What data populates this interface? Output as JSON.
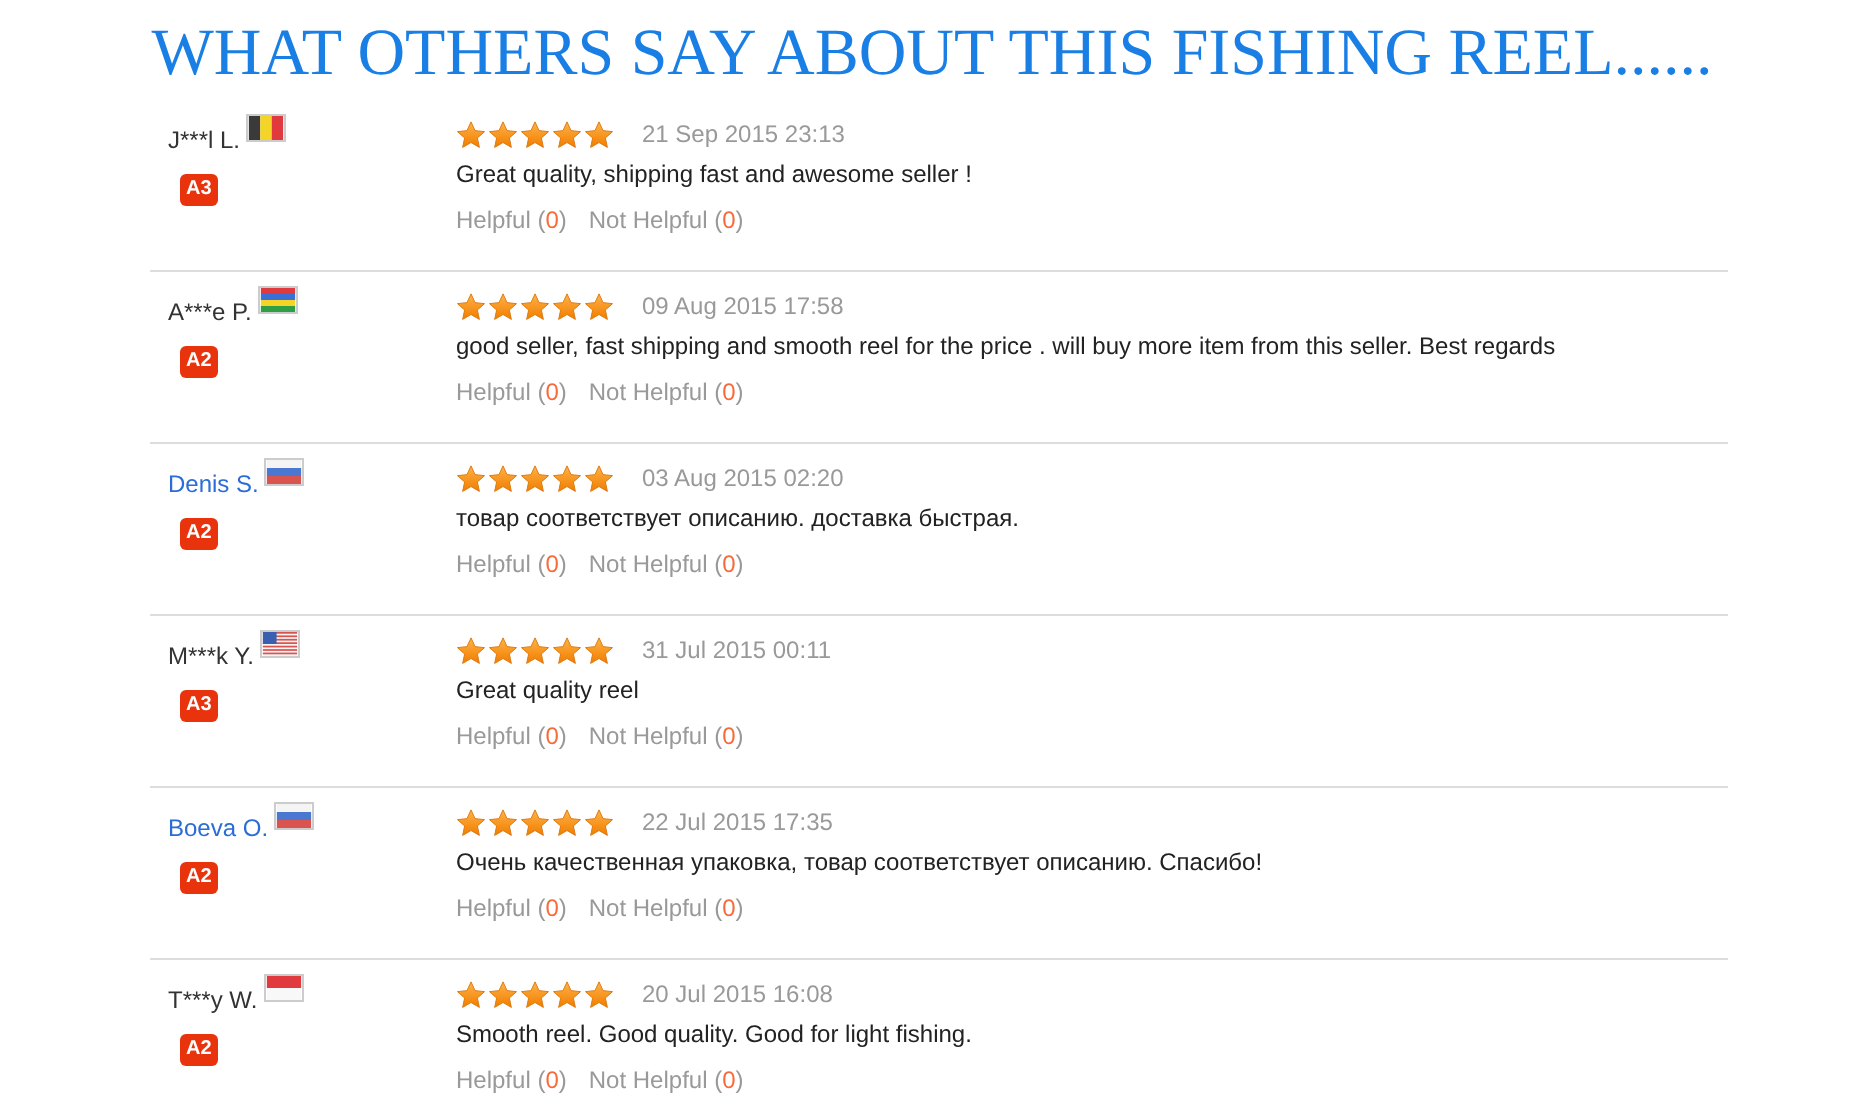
{
  "title": "WHAT OTHERS SAY ABOUT THIS FISHING REEL......",
  "reviews": [
    {
      "name": "J***l L.",
      "name_link": false,
      "badge": "A3",
      "stars": 5,
      "date": "21 Sep 2015 23:13",
      "text": "Great quality, shipping fast and awesome seller !",
      "helpful": [
        "Helpful (",
        "0",
        ")"
      ],
      "not_helpful": [
        "Not Helpful (",
        "0",
        ")"
      ]
    },
    {
      "name": "A***e P.",
      "name_link": false,
      "badge": "A2",
      "stars": 5,
      "date": "09 Aug 2015 17:58",
      "text": "good seller, fast shipping and smooth reel for the price . will buy more item from this seller. Best regards",
      "helpful": [
        "Helpful (",
        "0",
        ")"
      ],
      "not_helpful": [
        "Not Helpful (",
        "0",
        ")"
      ]
    },
    {
      "name": "Denis S.",
      "name_link": true,
      "badge": "A2",
      "stars": 5,
      "date": "03 Aug 2015 02:20",
      "text": "товар соответствует описанию. доставка быстрая.",
      "helpful": [
        "Helpful (",
        "0",
        ")"
      ],
      "not_helpful": [
        "Not Helpful (",
        "0",
        ")"
      ]
    },
    {
      "name": "M***k Y.",
      "name_link": false,
      "badge": "A3",
      "stars": 5,
      "date": "31 Jul 2015 00:11",
      "text": "Great quality reel",
      "helpful": [
        "Helpful (",
        "0",
        ")"
      ],
      "not_helpful": [
        "Not Helpful (",
        "0",
        ")"
      ]
    },
    {
      "name": "Boeva O.",
      "name_link": true,
      "badge": "A2",
      "stars": 5,
      "date": "22 Jul 2015 17:35",
      "text": "Очень качественная упаковка, товар соответствует описанию. Спасибо!",
      "helpful": [
        "Helpful (",
        "0",
        ")"
      ],
      "not_helpful": [
        "Not Helpful (",
        "0",
        ")"
      ]
    },
    {
      "name": "T***y W.",
      "name_link": false,
      "badge": "A2",
      "stars": 5,
      "date": "20 Jul 2015 16:08",
      "text": "Smooth reel. Good quality. Good for light fishing.",
      "helpful": [
        "Helpful (",
        "0",
        ")"
      ],
      "not_helpful": [
        "Not Helpful (",
        "0",
        ")"
      ]
    }
  ]
}
